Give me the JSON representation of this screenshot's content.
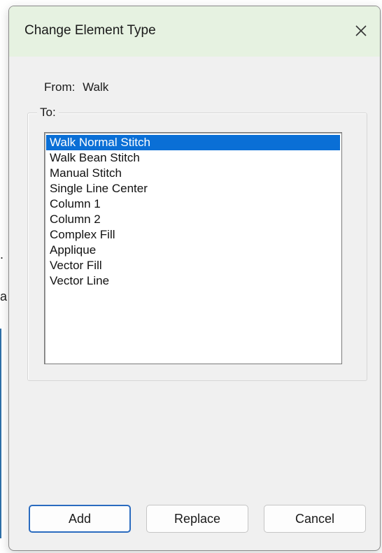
{
  "background": {
    "fragment_a": "a",
    "fragment_b": "."
  },
  "dialog": {
    "title": "Change Element Type",
    "close_icon": "close-icon",
    "from_label": "From:",
    "from_value": "Walk",
    "to_label": "To:",
    "list_items": [
      "Walk Normal Stitch",
      "Walk Bean Stitch",
      "Manual Stitch",
      "Single Line Center",
      "Column 1",
      "Column 2",
      "Complex Fill",
      "Applique",
      "Vector Fill",
      "Vector Line"
    ],
    "selected_item": "Walk Normal Stitch",
    "buttons": {
      "add": "Add",
      "replace": "Replace",
      "cancel": "Cancel"
    }
  },
  "colors": {
    "titlebar": "#e6f2e1",
    "selection": "#0a6fd6",
    "default_button_border": "#2a6bbf"
  }
}
